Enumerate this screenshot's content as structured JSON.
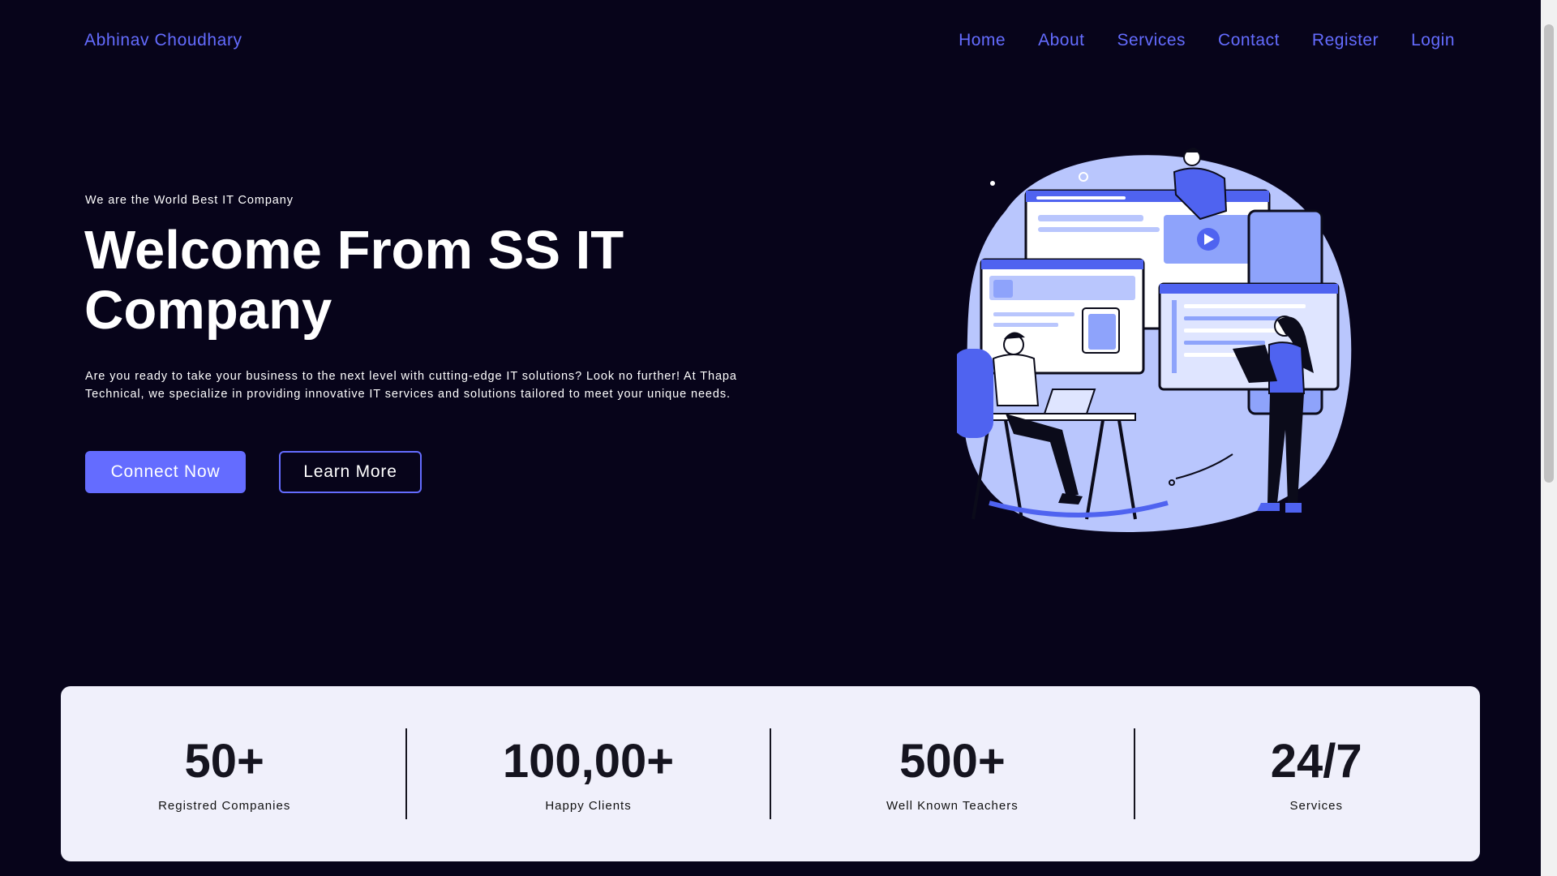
{
  "header": {
    "brand": "Abhinav Choudhary",
    "nav": [
      "Home",
      "About",
      "Services",
      "Contact",
      "Register",
      "Login"
    ]
  },
  "hero": {
    "tagline": "We are the World Best IT Company",
    "title": "Welcome From SS IT Company",
    "description": "Are you ready to take your business to the next level with cutting-edge IT solutions? Look no further! At Thapa Technical, we specialize in providing innovative IT services and solutions tailored to meet your unique needs.",
    "primary_button": "Connect Now",
    "secondary_button": "Learn More",
    "illustration_icon": "team-working-illustration"
  },
  "stats": [
    {
      "value": "50+",
      "label": "Registred Companies"
    },
    {
      "value": "100,00+",
      "label": "Happy Clients"
    },
    {
      "value": "500+",
      "label": "Well Known Teachers"
    },
    {
      "value": "24/7",
      "label": "Services"
    }
  ],
  "colors": {
    "background": "#07041a",
    "accent": "#646cff",
    "stats_bg": "#f0f0fb"
  }
}
